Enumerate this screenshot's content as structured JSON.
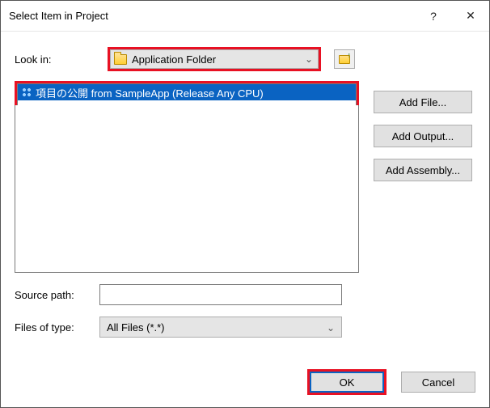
{
  "window": {
    "title": "Select Item in Project",
    "help_symbol": "?",
    "close_symbol": "✕"
  },
  "lookin": {
    "label": "Look in:",
    "selected": "Application Folder"
  },
  "list": {
    "items": [
      {
        "label": "項目の公開 from SampleApp (Release Any CPU)",
        "selected": true
      }
    ]
  },
  "side_buttons": {
    "add_file": "Add File...",
    "add_output": "Add Output...",
    "add_assembly": "Add Assembly..."
  },
  "form": {
    "source_path_label": "Source path:",
    "source_path_value": "",
    "files_of_type_label": "Files of type:",
    "files_of_type_value": "All Files (*.*)"
  },
  "buttons": {
    "ok": "OK",
    "cancel": "Cancel"
  },
  "colors": {
    "highlight": "#e81123",
    "selection": "#0a63c2"
  }
}
